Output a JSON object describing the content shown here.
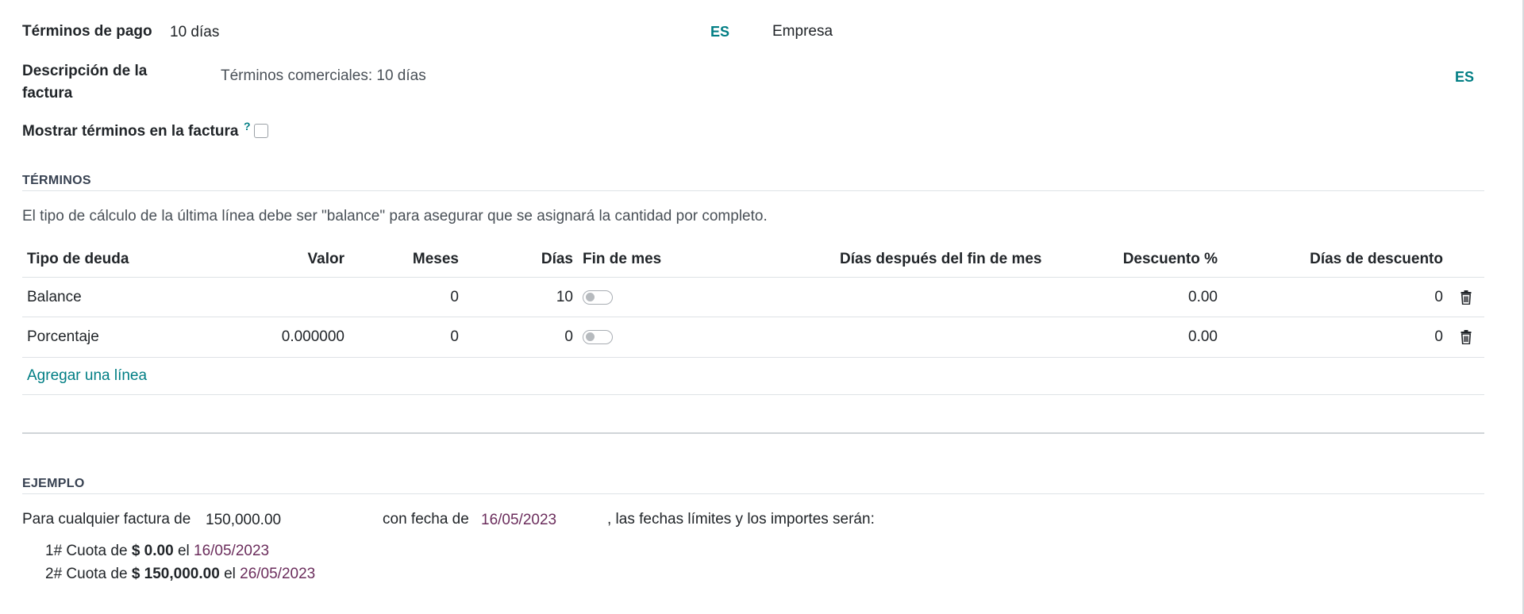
{
  "form": {
    "payment_terms_label": "Términos de pago",
    "payment_terms_value": "10 días",
    "payment_terms_lang": "ES",
    "company_label": "Empresa",
    "invoice_desc_label_line1": "Descripción de la",
    "invoice_desc_label_line2": "factura",
    "invoice_desc_value": "Términos comerciales: 10 días",
    "invoice_desc_lang": "ES",
    "show_terms_label": "Mostrar términos en la factura",
    "show_terms_help": "?",
    "show_terms_checked": false
  },
  "terms": {
    "section_title": "TÉRMINOS",
    "notice": "El tipo de cálculo de la última línea debe ser \"balance\" para asegurar que se asignará la cantidad por completo.",
    "columns": {
      "type": "Tipo de deuda",
      "value": "Valor",
      "months": "Meses",
      "days": "Días",
      "end_of_month": "Fin de mes",
      "days_after_eom": "Días después del fin de mes",
      "discount_pct": "Descuento %",
      "discount_days": "Días de descuento"
    },
    "rows": [
      {
        "type": "Balance",
        "value": "",
        "months": "0",
        "days": "10",
        "end_of_month": false,
        "days_after_eom": "",
        "discount_pct": "0.00",
        "discount_days": "0"
      },
      {
        "type": "Porcentaje",
        "value": "0.000000",
        "months": "0",
        "days": "0",
        "end_of_month": false,
        "days_after_eom": "",
        "discount_pct": "0.00",
        "discount_days": "0"
      }
    ],
    "add_line": "Agregar una línea"
  },
  "example": {
    "section_title": "EJEMPLO",
    "prefix": "Para cualquier factura de",
    "amount": "150,000.00",
    "date_prefix": "con fecha de",
    "date": "16/05/2023",
    "suffix": ", las fechas límites y los importes serán:",
    "installments": [
      {
        "index": "1#",
        "text": "Cuota de",
        "amount": "$ 0.00",
        "on": "el",
        "date": "16/05/2023"
      },
      {
        "index": "2#",
        "text": "Cuota de",
        "amount": "$ 150,000.00",
        "on": "el",
        "date": "26/05/2023"
      }
    ]
  },
  "colors": {
    "accent": "#017e84",
    "date": "#6b2d5c"
  }
}
